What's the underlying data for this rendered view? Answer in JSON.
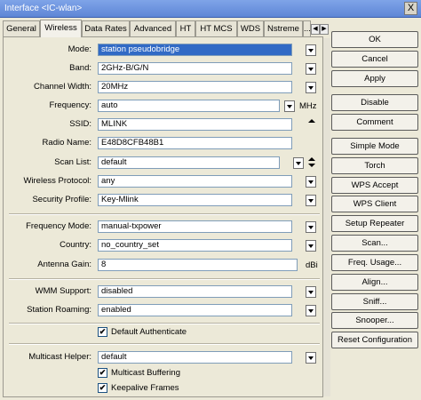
{
  "window": {
    "title": "Interface <IC-wlan>",
    "close_label": "X"
  },
  "tabs": [
    "General",
    "Wireless",
    "Data Rates",
    "Advanced",
    "HT",
    "HT MCS",
    "WDS",
    "Nstreme",
    "..."
  ],
  "active_tab": "Wireless",
  "tab_nav": {
    "left": "◀",
    "right": "▶"
  },
  "form": {
    "mode": {
      "label": "Mode:",
      "value": "station pseudobridge"
    },
    "band": {
      "label": "Band:",
      "value": "2GHz-B/G/N"
    },
    "channel_width": {
      "label": "Channel Width:",
      "value": "20MHz"
    },
    "frequency": {
      "label": "Frequency:",
      "value": "auto",
      "unit": "MHz"
    },
    "ssid": {
      "label": "SSID:",
      "value": "MLINK"
    },
    "radio_name": {
      "label": "Radio Name:",
      "value": "E48D8CFB48B1"
    },
    "scan_list": {
      "label": "Scan List:",
      "value": "default"
    },
    "wireless_protocol": {
      "label": "Wireless Protocol:",
      "value": "any"
    },
    "security_profile": {
      "label": "Security Profile:",
      "value": "Key-Mlink"
    },
    "frequency_mode": {
      "label": "Frequency Mode:",
      "value": "manual-txpower"
    },
    "country": {
      "label": "Country:",
      "value": "no_country_set"
    },
    "antenna_gain": {
      "label": "Antenna Gain:",
      "value": "8",
      "unit": "dBi"
    },
    "wmm_support": {
      "label": "WMM Support:",
      "value": "disabled"
    },
    "station_roaming": {
      "label": "Station Roaming:",
      "value": "enabled"
    },
    "default_authenticate": {
      "label": "Default Authenticate",
      "checked": true
    },
    "multicast_helper": {
      "label": "Multicast Helper:",
      "value": "default"
    },
    "multicast_buffering": {
      "label": "Multicast Buffering",
      "checked": true
    },
    "keepalive_frames": {
      "label": "Keepalive Frames",
      "checked": true
    }
  },
  "check_mark": "✔",
  "buttons": [
    "OK",
    "Cancel",
    "Apply",
    "Disable",
    "Comment",
    "Simple Mode",
    "Torch",
    "WPS Accept",
    "WPS Client",
    "Setup Repeater",
    "Scan...",
    "Freq. Usage...",
    "Align...",
    "Sniff...",
    "Snooper...",
    "Reset Configuration"
  ],
  "colors": {
    "title_bar": "#6B93E0",
    "selected": "#316AC5",
    "window_bg": "#ECE9D8"
  }
}
